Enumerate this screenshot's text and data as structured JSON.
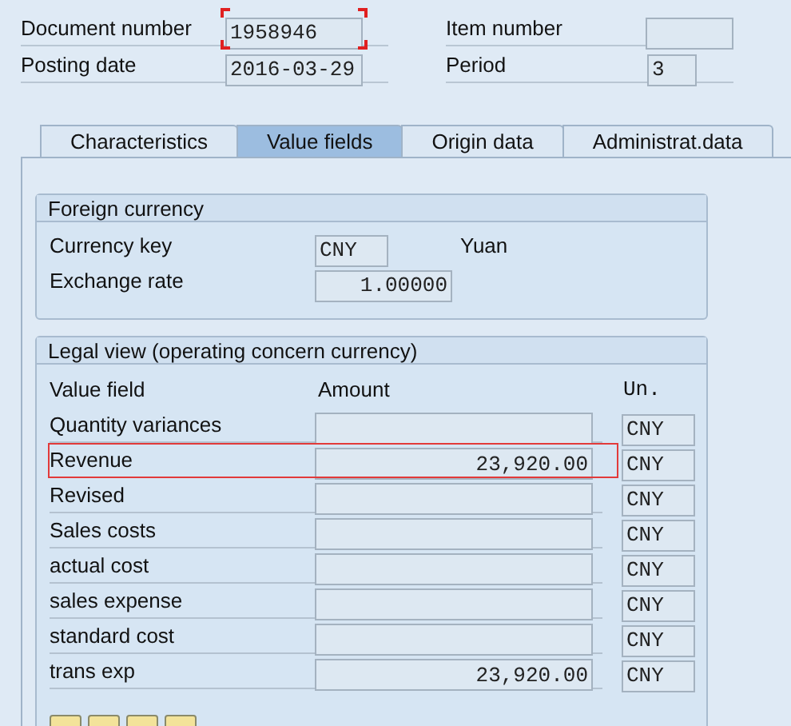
{
  "header": {
    "left": [
      {
        "label": "Document number",
        "value": "1958946",
        "focused": true
      },
      {
        "label": "Posting date",
        "value": "2016-03-29",
        "focused": false
      }
    ],
    "right": [
      {
        "label": "Item number",
        "focused": false
      },
      {
        "label": "Period",
        "value": "3",
        "focused": false
      }
    ]
  },
  "tabs": [
    {
      "label": "Characteristics",
      "selected": false
    },
    {
      "label": "Value fields",
      "selected": true
    },
    {
      "label": "Origin data",
      "selected": false
    },
    {
      "label": "Administrat.data",
      "selected": false
    }
  ],
  "foreign_currency": {
    "title": "Foreign currency",
    "currency_key": {
      "label": "Currency key",
      "value": "CNY",
      "description": "Yuan"
    },
    "exchange_rate": {
      "label": "Exchange rate",
      "value": "1.00000"
    }
  },
  "legal_view": {
    "title": "Legal view (operating concern currency)",
    "columns": [
      "Value field",
      "Amount",
      "Un."
    ],
    "rows": [
      {
        "name": "Quantity variances",
        "unit": "CNY",
        "highlighted": false
      },
      {
        "name": "Revenue",
        "amount": "23,920.00",
        "unit": "CNY",
        "highlighted": true
      },
      {
        "name": "Revised",
        "unit": "CNY",
        "highlighted": false
      },
      {
        "name": "Sales costs",
        "unit": "CNY",
        "highlighted": false
      },
      {
        "name": "actual cost",
        "unit": "CNY",
        "highlighted": false
      },
      {
        "name": "sales expense",
        "unit": "CNY",
        "highlighted": false
      },
      {
        "name": "standard cost",
        "unit": "CNY",
        "highlighted": false
      },
      {
        "name": "trans exp",
        "amount": "23,920.00",
        "unit": "CNY",
        "highlighted": false
      }
    ]
  }
}
